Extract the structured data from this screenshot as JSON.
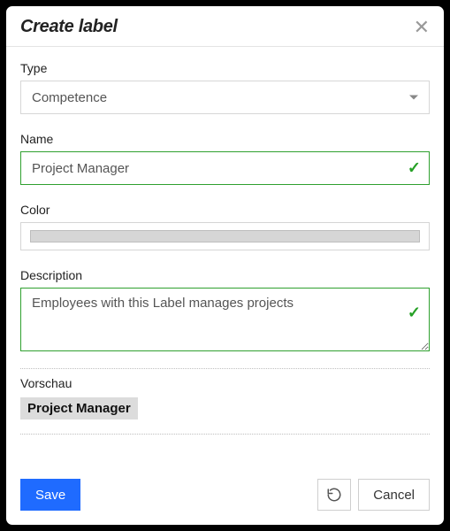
{
  "dialog": {
    "title": "Create label"
  },
  "fields": {
    "type": {
      "label": "Type",
      "value": "Competence"
    },
    "name": {
      "label": "Name",
      "value": "Project Manager",
      "valid": true
    },
    "color": {
      "label": "Color"
    },
    "description": {
      "label": "Description",
      "value": "Employees with this Label manages projects",
      "valid": true
    }
  },
  "preview": {
    "label": "Vorschau",
    "chip_text": "Project Manager"
  },
  "footer": {
    "save": "Save",
    "cancel": "Cancel"
  }
}
